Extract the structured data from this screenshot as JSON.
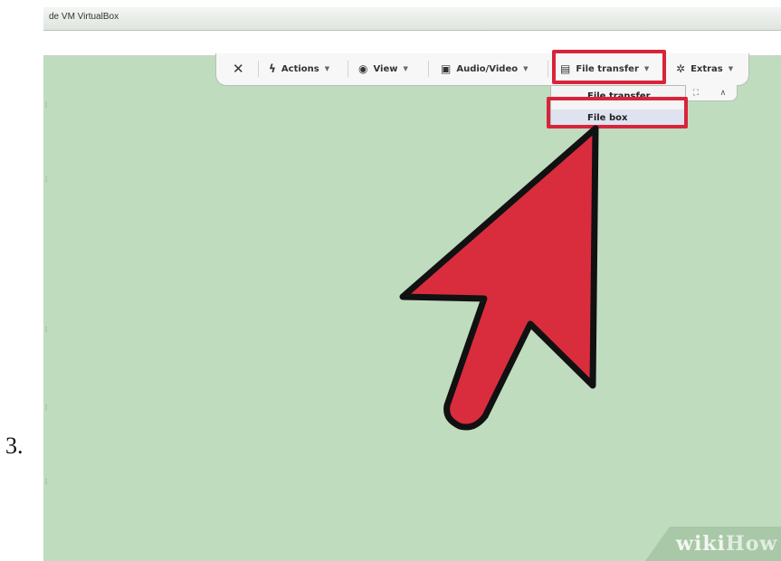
{
  "step": {
    "number": "3."
  },
  "window": {
    "title": "de VM VirtualBox"
  },
  "toolbar": {
    "items": [
      {
        "label": "",
        "icon": "close-icon"
      },
      {
        "label": "Actions",
        "icon": "lightning-icon"
      },
      {
        "label": "View",
        "icon": "eye-icon"
      },
      {
        "label": "Audio/Video",
        "icon": "chat-icon"
      },
      {
        "label": "File transfer",
        "icon": "clipboard-icon"
      },
      {
        "label": "Extras",
        "icon": "star-icon"
      }
    ]
  },
  "dropdown": {
    "items": [
      {
        "label": "File transfer"
      },
      {
        "label": "File box"
      }
    ],
    "selected": "File box"
  },
  "highlight_color": "#d8243a",
  "arrow_color": "#d92d3e",
  "watermark": {
    "part1": "wiki",
    "part2": "How"
  },
  "colors": {
    "background": "#bfdcbf",
    "toolbar": "#f6f7f6"
  }
}
